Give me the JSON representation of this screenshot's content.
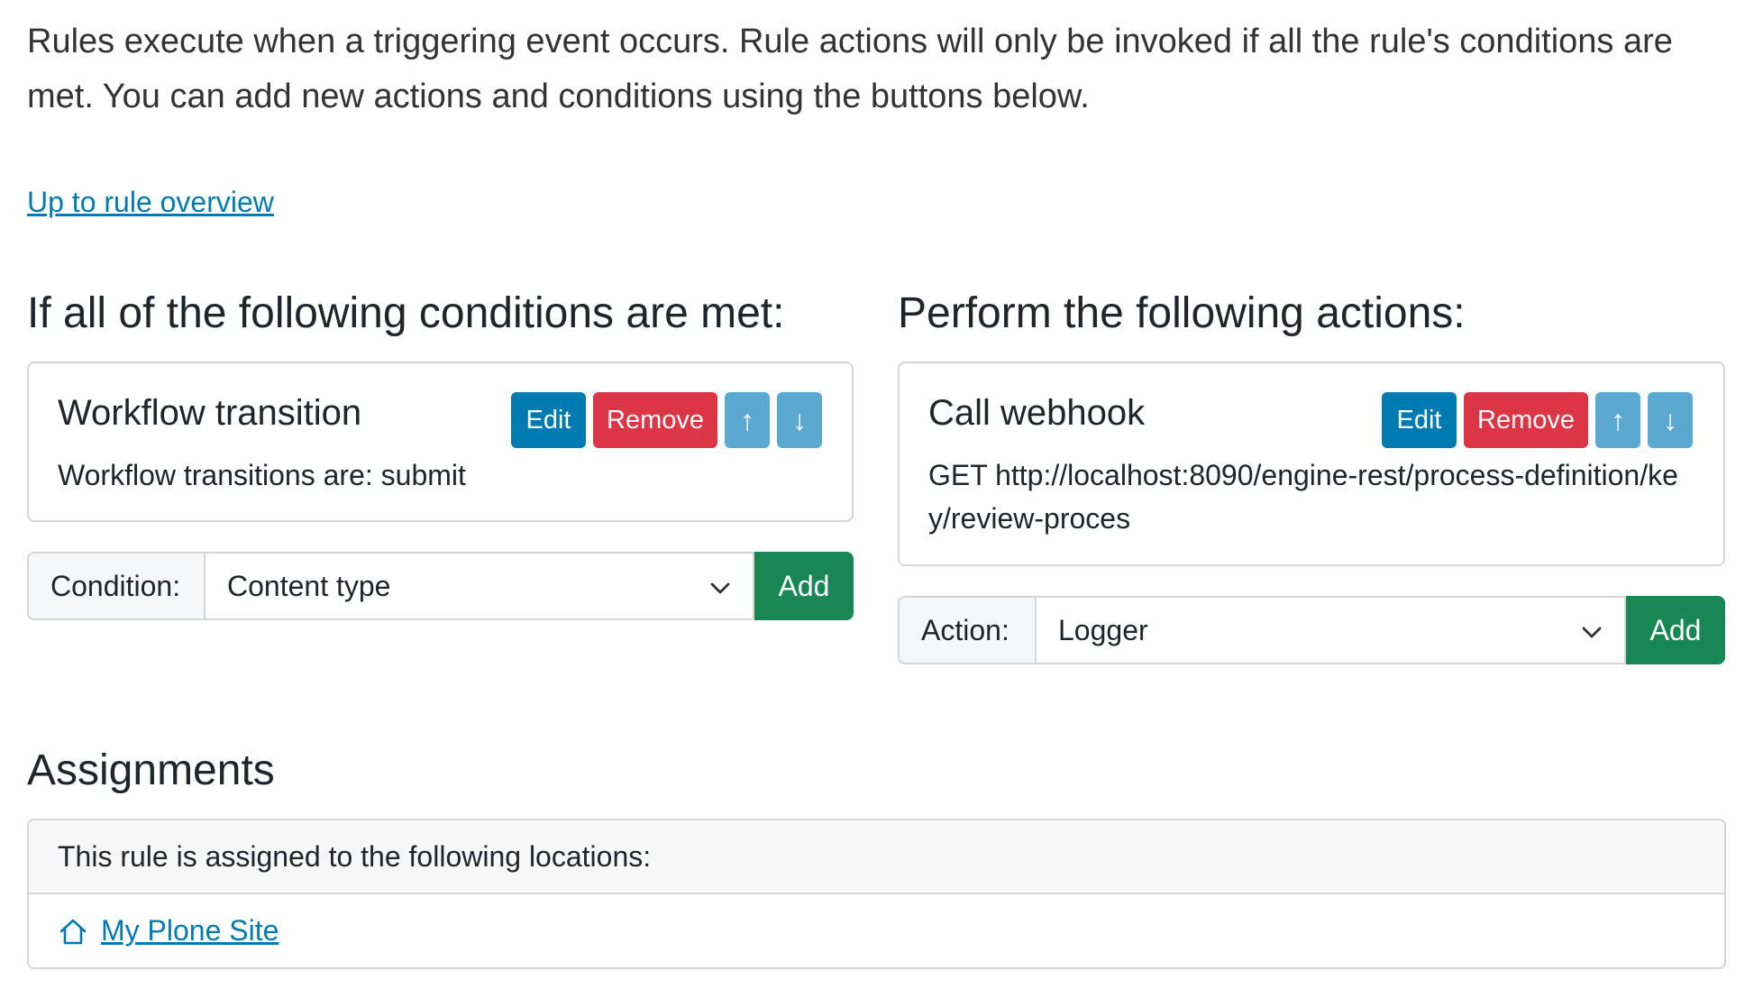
{
  "intro": {
    "text": "Rules execute when a triggering event occurs. Rule actions will only be invoked if all the rule's conditions are met. You can add new actions and conditions using the buttons below."
  },
  "overview_link": {
    "label": "Up to rule overview"
  },
  "conditions": {
    "heading": "If all of the following conditions are met:",
    "item": {
      "title": "Workflow transition",
      "description": "Workflow transitions are: submit",
      "edit_label": "Edit",
      "remove_label": "Remove",
      "up_label": "↑",
      "down_label": "↓"
    },
    "selector": {
      "label": "Condition:",
      "selected": "Content type",
      "add_label": "Add"
    }
  },
  "actions": {
    "heading": "Perform the following actions:",
    "item": {
      "title": "Call webhook",
      "description": "GET http://localhost:8090/engine-rest/process-definition/key/review-proces",
      "edit_label": "Edit",
      "remove_label": "Remove",
      "up_label": "↑",
      "down_label": "↓"
    },
    "selector": {
      "label": "Action:",
      "selected": "Logger",
      "add_label": "Add"
    }
  },
  "assignments": {
    "heading": "Assignments",
    "subheading": "This rule is assigned to the following locations:",
    "locations": [
      {
        "label": "My Plone Site",
        "icon": "home-icon"
      }
    ]
  },
  "colors": {
    "primary": "#007bb1",
    "danger": "#dc3545",
    "info": "#5ba8d1",
    "success": "#198754"
  }
}
